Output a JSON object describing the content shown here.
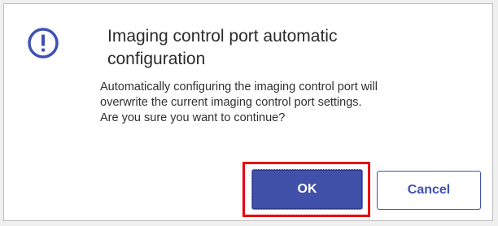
{
  "dialog": {
    "title_line1": "Imaging control port automatic",
    "title_line2": "configuration",
    "message_lines": [
      "Automatically configuring the imaging control port will",
      "overwrite the current imaging control port settings.",
      "Are you sure you want to continue?"
    ],
    "icon": "info-icon",
    "accent_color": "#3f51b5",
    "highlight_color": "#e8000f"
  },
  "buttons": {
    "ok_label": "OK",
    "cancel_label": "Cancel"
  }
}
